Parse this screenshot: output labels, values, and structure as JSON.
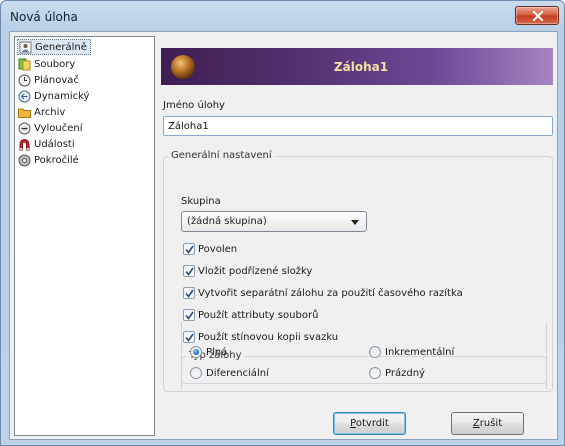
{
  "window": {
    "title": "Nová úloha",
    "close_label": "×"
  },
  "nav": {
    "items": [
      {
        "label": "Generálně",
        "icon": "document-person-icon",
        "selected": true
      },
      {
        "label": "Soubory",
        "icon": "files-icon"
      },
      {
        "label": "Plánovač",
        "icon": "clock-icon"
      },
      {
        "label": "Dynamický",
        "icon": "dynamic-icon"
      },
      {
        "label": "Archiv",
        "icon": "folder-icon"
      },
      {
        "label": "Vyloučení",
        "icon": "minus-circle-icon"
      },
      {
        "label": "Události",
        "icon": "magnet-icon"
      },
      {
        "label": "Pokročilé",
        "icon": "gear-icon"
      }
    ]
  },
  "banner": {
    "title": "Záloha1"
  },
  "task_name": {
    "label": "Jméno úlohy",
    "value": "Záloha1"
  },
  "general": {
    "group_label": "Generální nastavení",
    "group_field_label": "Skupina",
    "group_value": "(žádná skupina)",
    "checkboxes": [
      {
        "label": "Povolen",
        "checked": true
      },
      {
        "label": "Vložit podřízené složky",
        "checked": true
      },
      {
        "label": "Vytvořit separátní zálohu za použití časového razítka",
        "checked": true
      },
      {
        "label": "Použít attributy souborů",
        "checked": true
      },
      {
        "label": "Použít stínovou kopii svazku",
        "checked": true
      }
    ]
  },
  "backup_type": {
    "label": "Typ zálohy",
    "options": [
      {
        "label": "Plná",
        "selected": true
      },
      {
        "label": "Inkrementální",
        "selected": false
      },
      {
        "label": "Diferenciální",
        "selected": false
      },
      {
        "label": "Prázdný",
        "selected": false
      }
    ]
  },
  "buttons": {
    "ok_label_underlined": "P",
    "ok_label_rest": "otvrdit",
    "cancel_label_underlined": "Z",
    "cancel_label_rest": "rušit"
  },
  "colors": {
    "banner_start": "#3e1e52",
    "banner_end": "#a883c2",
    "banner_text": "#f3e3a1",
    "close_button": "#c33a1f"
  }
}
